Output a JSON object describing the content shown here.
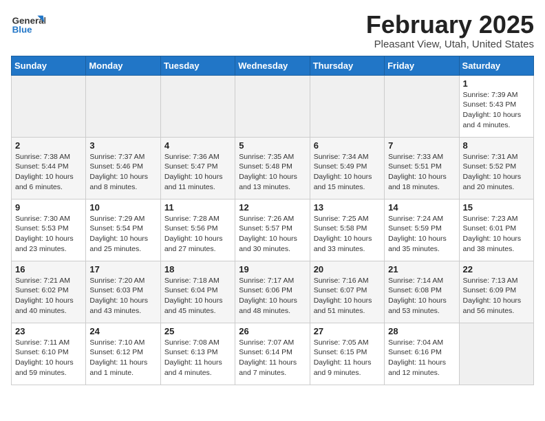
{
  "header": {
    "logo_line1": "General",
    "logo_line2": "Blue",
    "month": "February 2025",
    "location": "Pleasant View, Utah, United States"
  },
  "weekdays": [
    "Sunday",
    "Monday",
    "Tuesday",
    "Wednesday",
    "Thursday",
    "Friday",
    "Saturday"
  ],
  "weeks": [
    [
      {
        "day": "",
        "info": ""
      },
      {
        "day": "",
        "info": ""
      },
      {
        "day": "",
        "info": ""
      },
      {
        "day": "",
        "info": ""
      },
      {
        "day": "",
        "info": ""
      },
      {
        "day": "",
        "info": ""
      },
      {
        "day": "1",
        "info": "Sunrise: 7:39 AM\nSunset: 5:43 PM\nDaylight: 10 hours and 4 minutes."
      }
    ],
    [
      {
        "day": "2",
        "info": "Sunrise: 7:38 AM\nSunset: 5:44 PM\nDaylight: 10 hours and 6 minutes."
      },
      {
        "day": "3",
        "info": "Sunrise: 7:37 AM\nSunset: 5:46 PM\nDaylight: 10 hours and 8 minutes."
      },
      {
        "day": "4",
        "info": "Sunrise: 7:36 AM\nSunset: 5:47 PM\nDaylight: 10 hours and 11 minutes."
      },
      {
        "day": "5",
        "info": "Sunrise: 7:35 AM\nSunset: 5:48 PM\nDaylight: 10 hours and 13 minutes."
      },
      {
        "day": "6",
        "info": "Sunrise: 7:34 AM\nSunset: 5:49 PM\nDaylight: 10 hours and 15 minutes."
      },
      {
        "day": "7",
        "info": "Sunrise: 7:33 AM\nSunset: 5:51 PM\nDaylight: 10 hours and 18 minutes."
      },
      {
        "day": "8",
        "info": "Sunrise: 7:31 AM\nSunset: 5:52 PM\nDaylight: 10 hours and 20 minutes."
      }
    ],
    [
      {
        "day": "9",
        "info": "Sunrise: 7:30 AM\nSunset: 5:53 PM\nDaylight: 10 hours and 23 minutes."
      },
      {
        "day": "10",
        "info": "Sunrise: 7:29 AM\nSunset: 5:54 PM\nDaylight: 10 hours and 25 minutes."
      },
      {
        "day": "11",
        "info": "Sunrise: 7:28 AM\nSunset: 5:56 PM\nDaylight: 10 hours and 27 minutes."
      },
      {
        "day": "12",
        "info": "Sunrise: 7:26 AM\nSunset: 5:57 PM\nDaylight: 10 hours and 30 minutes."
      },
      {
        "day": "13",
        "info": "Sunrise: 7:25 AM\nSunset: 5:58 PM\nDaylight: 10 hours and 33 minutes."
      },
      {
        "day": "14",
        "info": "Sunrise: 7:24 AM\nSunset: 5:59 PM\nDaylight: 10 hours and 35 minutes."
      },
      {
        "day": "15",
        "info": "Sunrise: 7:23 AM\nSunset: 6:01 PM\nDaylight: 10 hours and 38 minutes."
      }
    ],
    [
      {
        "day": "16",
        "info": "Sunrise: 7:21 AM\nSunset: 6:02 PM\nDaylight: 10 hours and 40 minutes."
      },
      {
        "day": "17",
        "info": "Sunrise: 7:20 AM\nSunset: 6:03 PM\nDaylight: 10 hours and 43 minutes."
      },
      {
        "day": "18",
        "info": "Sunrise: 7:18 AM\nSunset: 6:04 PM\nDaylight: 10 hours and 45 minutes."
      },
      {
        "day": "19",
        "info": "Sunrise: 7:17 AM\nSunset: 6:06 PM\nDaylight: 10 hours and 48 minutes."
      },
      {
        "day": "20",
        "info": "Sunrise: 7:16 AM\nSunset: 6:07 PM\nDaylight: 10 hours and 51 minutes."
      },
      {
        "day": "21",
        "info": "Sunrise: 7:14 AM\nSunset: 6:08 PM\nDaylight: 10 hours and 53 minutes."
      },
      {
        "day": "22",
        "info": "Sunrise: 7:13 AM\nSunset: 6:09 PM\nDaylight: 10 hours and 56 minutes."
      }
    ],
    [
      {
        "day": "23",
        "info": "Sunrise: 7:11 AM\nSunset: 6:10 PM\nDaylight: 10 hours and 59 minutes."
      },
      {
        "day": "24",
        "info": "Sunrise: 7:10 AM\nSunset: 6:12 PM\nDaylight: 11 hours and 1 minute."
      },
      {
        "day": "25",
        "info": "Sunrise: 7:08 AM\nSunset: 6:13 PM\nDaylight: 11 hours and 4 minutes."
      },
      {
        "day": "26",
        "info": "Sunrise: 7:07 AM\nSunset: 6:14 PM\nDaylight: 11 hours and 7 minutes."
      },
      {
        "day": "27",
        "info": "Sunrise: 7:05 AM\nSunset: 6:15 PM\nDaylight: 11 hours and 9 minutes."
      },
      {
        "day": "28",
        "info": "Sunrise: 7:04 AM\nSunset: 6:16 PM\nDaylight: 11 hours and 12 minutes."
      },
      {
        "day": "",
        "info": ""
      }
    ]
  ]
}
